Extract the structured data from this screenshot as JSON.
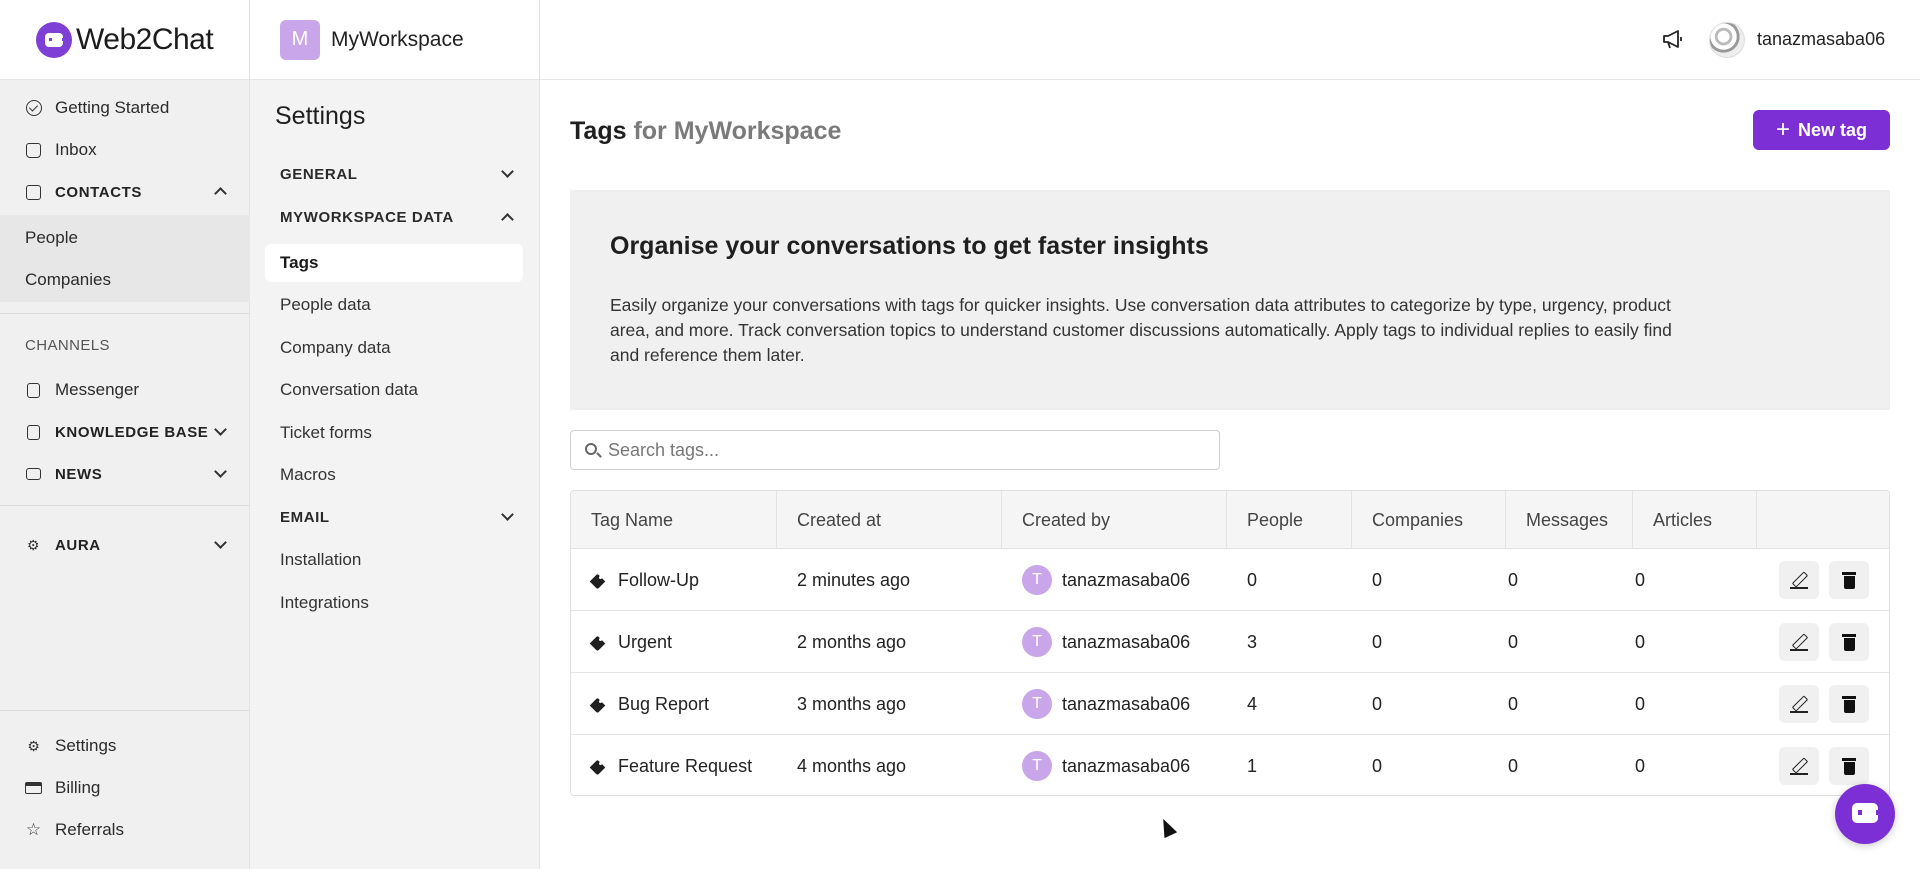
{
  "brand": {
    "name": "Web2Chat"
  },
  "nav": {
    "getting_started": "Getting Started",
    "inbox": "Inbox",
    "contacts": "CONTACTS",
    "people": "People",
    "companies": "Companies",
    "channels_caption": "CHANNELS",
    "messenger": "Messenger",
    "knowledge_base": "KNOWLEDGE BASE",
    "news": "NEWS",
    "aura": "AURA",
    "settings": "Settings",
    "billing": "Billing",
    "referrals": "Referrals"
  },
  "workspace": {
    "initial": "M",
    "name": "MyWorkspace"
  },
  "settings_menu": {
    "title": "Settings",
    "general": "GENERAL",
    "data_section": "MYWORKSPACE DATA",
    "tags": "Tags",
    "people_data": "People data",
    "company_data": "Company data",
    "conversation_data": "Conversation data",
    "ticket_forms": "Ticket forms",
    "macros": "Macros",
    "email": "EMAIL",
    "installation": "Installation",
    "integrations": "Integrations"
  },
  "topbar": {
    "username": "tanazmasaba06"
  },
  "main": {
    "title": "Tags",
    "title_suffix": "for MyWorkspace",
    "new_tag_label": "New tag",
    "banner_heading": "Organise your conversations to get faster insights",
    "banner_text": "Easily organize your conversations with tags for quicker insights. Use conversation data attributes to categorize by type, urgency, product area, and more. Track conversation topics to understand customer discussions automatically. Apply tags to individual replies to easily find and reference them later.",
    "search_placeholder": "Search tags..."
  },
  "table": {
    "columns": [
      "Tag Name",
      "Created at",
      "Created by",
      "People",
      "Companies",
      "Messages",
      "Articles"
    ],
    "rows": [
      {
        "name": "Follow-Up",
        "created_at": "2 minutes ago",
        "creator_initial": "T",
        "creator": "tanazmasaba06",
        "people": "0",
        "companies": "0",
        "messages": "0",
        "articles": "0"
      },
      {
        "name": "Urgent",
        "created_at": "2 months ago",
        "creator_initial": "T",
        "creator": "tanazmasaba06",
        "people": "3",
        "companies": "0",
        "messages": "0",
        "articles": "0"
      },
      {
        "name": "Bug Report",
        "created_at": "3 months ago",
        "creator_initial": "T",
        "creator": "tanazmasaba06",
        "people": "4",
        "companies": "0",
        "messages": "0",
        "articles": "0"
      },
      {
        "name": "Feature Request",
        "created_at": "4 months ago",
        "creator_initial": "T",
        "creator": "tanazmasaba06",
        "people": "1",
        "companies": "0",
        "messages": "0",
        "articles": "0"
      }
    ]
  },
  "colors": {
    "accent": "#7d2fd6",
    "avatar": "#c9a6ea"
  }
}
